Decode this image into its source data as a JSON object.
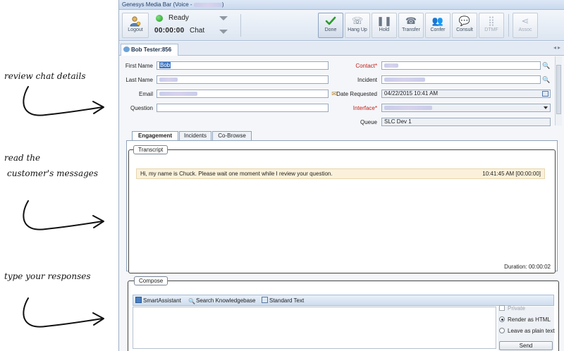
{
  "annotations": [
    {
      "text": "review chat details"
    },
    {
      "text": "read the"
    },
    {
      "text": "customer's messages"
    },
    {
      "text": "type your responses"
    }
  ],
  "window": {
    "title": "Genesys Media Bar (Voice - "
  },
  "toolbar": {
    "logout_label": "Logout",
    "status": "Ready",
    "timer": "00:00:00",
    "media": "Chat",
    "buttons": [
      {
        "label": "Done",
        "icon": "check-icon",
        "enabled": true
      },
      {
        "label": "Hang Up",
        "icon": "hang-up-icon",
        "enabled": false
      },
      {
        "label": "Hold",
        "icon": "pause-icon",
        "enabled": false
      },
      {
        "label": "Transfer",
        "icon": "transfer-icon",
        "enabled": false
      },
      {
        "label": "Confer",
        "icon": "conference-icon",
        "enabled": false
      },
      {
        "label": "Consult",
        "icon": "consult-icon",
        "enabled": false
      },
      {
        "label": "DTMF",
        "icon": "keypad-icon",
        "enabled": false
      },
      {
        "label": "Assoc",
        "icon": "share-icon",
        "enabled": false
      }
    ]
  },
  "interaction_tab": {
    "label": "Bob Tester:856"
  },
  "form": {
    "first_name_label": "First Name",
    "first_name_value": "Bob",
    "last_name_label": "Last Name",
    "email_label": "Email",
    "question_label": "Question",
    "contact_label": "Contact*",
    "incident_label": "Incident",
    "date_requested_label": "Date Requested",
    "date_requested_value": "04/22/2015 10:41 AM",
    "interface_label": "Interface*",
    "queue_label": "Queue",
    "queue_value": "SLC Dev 1"
  },
  "detail_tabs": [
    {
      "label": "Engagement",
      "active": true
    },
    {
      "label": "Incidents",
      "active": false
    },
    {
      "label": "Co-Browse",
      "active": false
    }
  ],
  "transcript": {
    "title": "Transcript",
    "messages": [
      {
        "text": "Hi, my name is Chuck. Please wait one moment while I review your question.",
        "time": "10:41:45 AM [00:00:00]"
      }
    ],
    "duration": "Duration: 00:00:02"
  },
  "compose": {
    "title": "Compose",
    "toolbar": {
      "smart_assistant": "SmartAssistant",
      "search_kb": "Search Knowledgebase",
      "standard_text": "Standard Text"
    },
    "options": {
      "private": "Private",
      "render_html": "Render as HTML",
      "plain_text": "Leave as plain text",
      "send": "Send"
    }
  },
  "colors": {
    "accent": "#3a75c4",
    "required": "#c0201b",
    "message_bg": "#fbf1da"
  }
}
